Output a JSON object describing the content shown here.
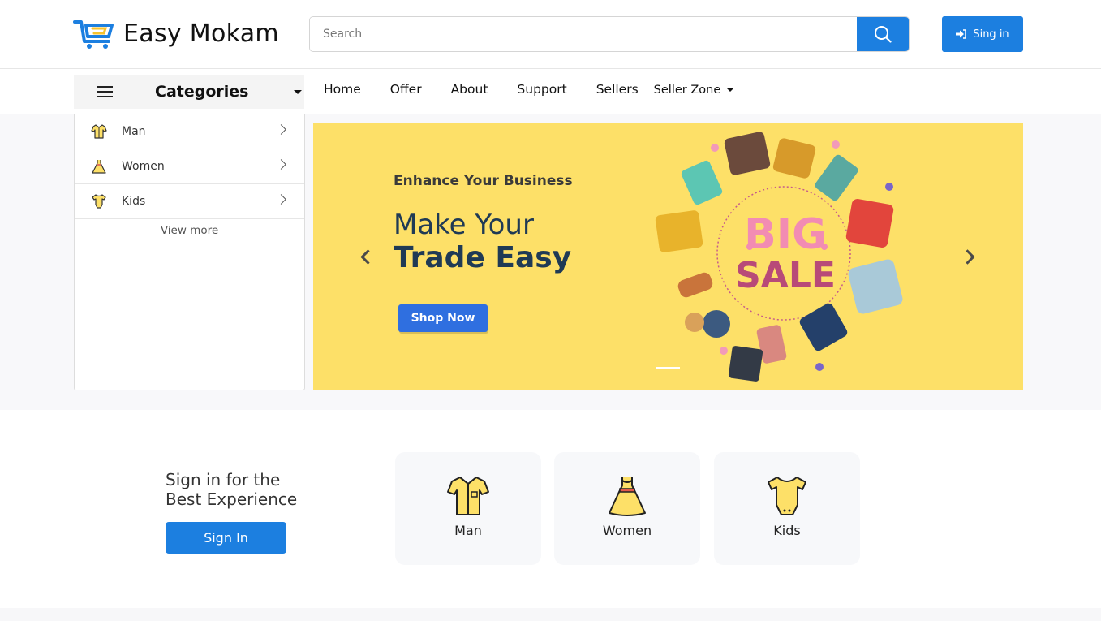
{
  "header": {
    "brand": "Easy Mokam",
    "search_placeholder": "Search",
    "signin_label": "Sing in",
    "accent": "#1c7fe0",
    "icons": [
      "cart-logo-icon",
      "search-icon",
      "sign-in-icon"
    ]
  },
  "nav": {
    "categories_label": "Categories",
    "links": [
      "Home",
      "Offer",
      "About",
      "Support",
      "Sellers"
    ],
    "dropdown_label": "Seller Zone"
  },
  "categories": {
    "items": [
      {
        "label": "Man",
        "icon": "shirt-icon"
      },
      {
        "label": "Women",
        "icon": "dress-icon"
      },
      {
        "label": "Kids",
        "icon": "baby-bodysuit-icon"
      }
    ],
    "view_more": "View more"
  },
  "banner": {
    "subtitle": "Enhance Your Business",
    "line1": "Make Your",
    "line2": "Trade Easy",
    "button": "Shop Now",
    "sale_word1": "BIG",
    "sale_word2": "SALE",
    "background": "#fde068"
  },
  "promo": {
    "line1": "Sign in for the",
    "line2": "Best Experience",
    "button": "Sign In"
  },
  "category_cards": [
    {
      "label": "Man",
      "icon": "shirt-icon"
    },
    {
      "label": "Women",
      "icon": "dress-icon"
    },
    {
      "label": "Kids",
      "icon": "baby-bodysuit-icon"
    }
  ]
}
